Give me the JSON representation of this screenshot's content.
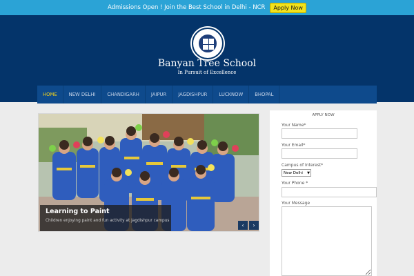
{
  "topbar": {
    "text": "Admissions Open ! Join the Best School in Delhi - NCR",
    "button": "Apply Now"
  },
  "header": {
    "logo_icon": "school-crest-icon",
    "school_name": "Banyan Tree School",
    "tagline": "In Pursuit of Excellence"
  },
  "nav": {
    "items": [
      "HOME",
      "NEW DELHI",
      "CHANDIGARH",
      "JAIPUR",
      "JAGDISHPUR",
      "LUCKNOW",
      "BHOPAL"
    ],
    "active_index": 0
  },
  "slider": {
    "caption_title": "Learning to Paint",
    "caption_sub": "Children enjoying paint and fun activity at Jagdishpur campus",
    "prev_icon": "chevron-left-icon",
    "next_icon": "chevron-right-icon"
  },
  "form": {
    "title": "APPLY NOW",
    "name_label": "Your Name*",
    "email_label": "Your Email*",
    "campus_label": "Campus of Interest*",
    "campus_value": "New Delhi",
    "phone_label": "Your Phone *",
    "message_label": "Your Message"
  },
  "colors": {
    "topbar": "#2ba3d6",
    "header": "#04346a",
    "nav": "#0e4a8c",
    "nav_active": "#f2d21c",
    "apply_button": "#f2e21c"
  }
}
